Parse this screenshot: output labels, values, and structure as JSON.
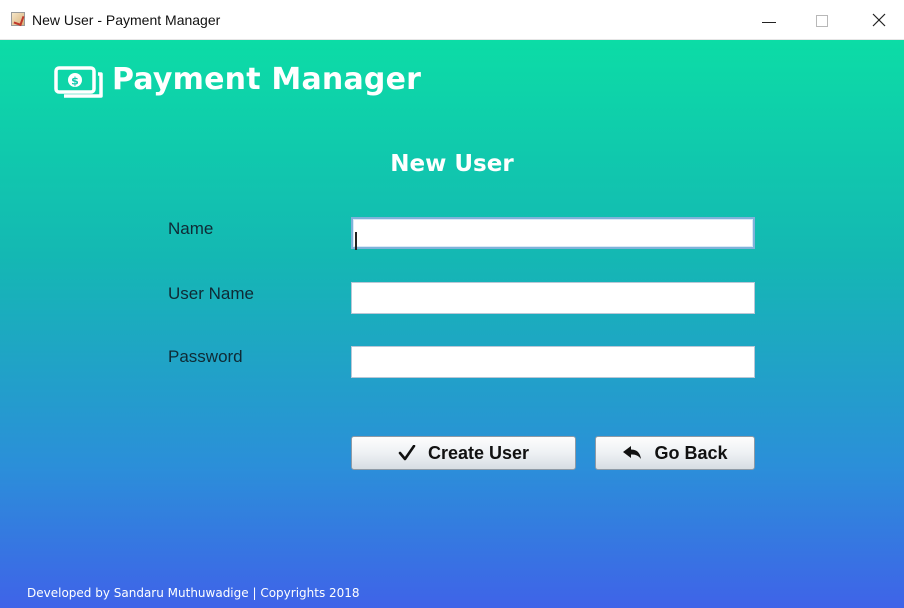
{
  "window": {
    "title": "New User - Payment Manager"
  },
  "brand": {
    "title": "Payment Manager",
    "icon": "money-icon"
  },
  "form": {
    "heading": "New User",
    "name_label": "Name",
    "name_value": "",
    "username_label": "User Name",
    "username_value": "",
    "password_label": "Password",
    "password_value": ""
  },
  "buttons": {
    "create_label": "Create User",
    "create_icon": "checkmark-icon",
    "back_label": "Go Back",
    "back_icon": "back-arrow-icon"
  },
  "footer": {
    "text": "Developed by Sandaru Muthuwadige | Copyrights 2018"
  },
  "colors": {
    "gradient_top": "#0cdca6",
    "gradient_bottom": "#3f63e8"
  }
}
